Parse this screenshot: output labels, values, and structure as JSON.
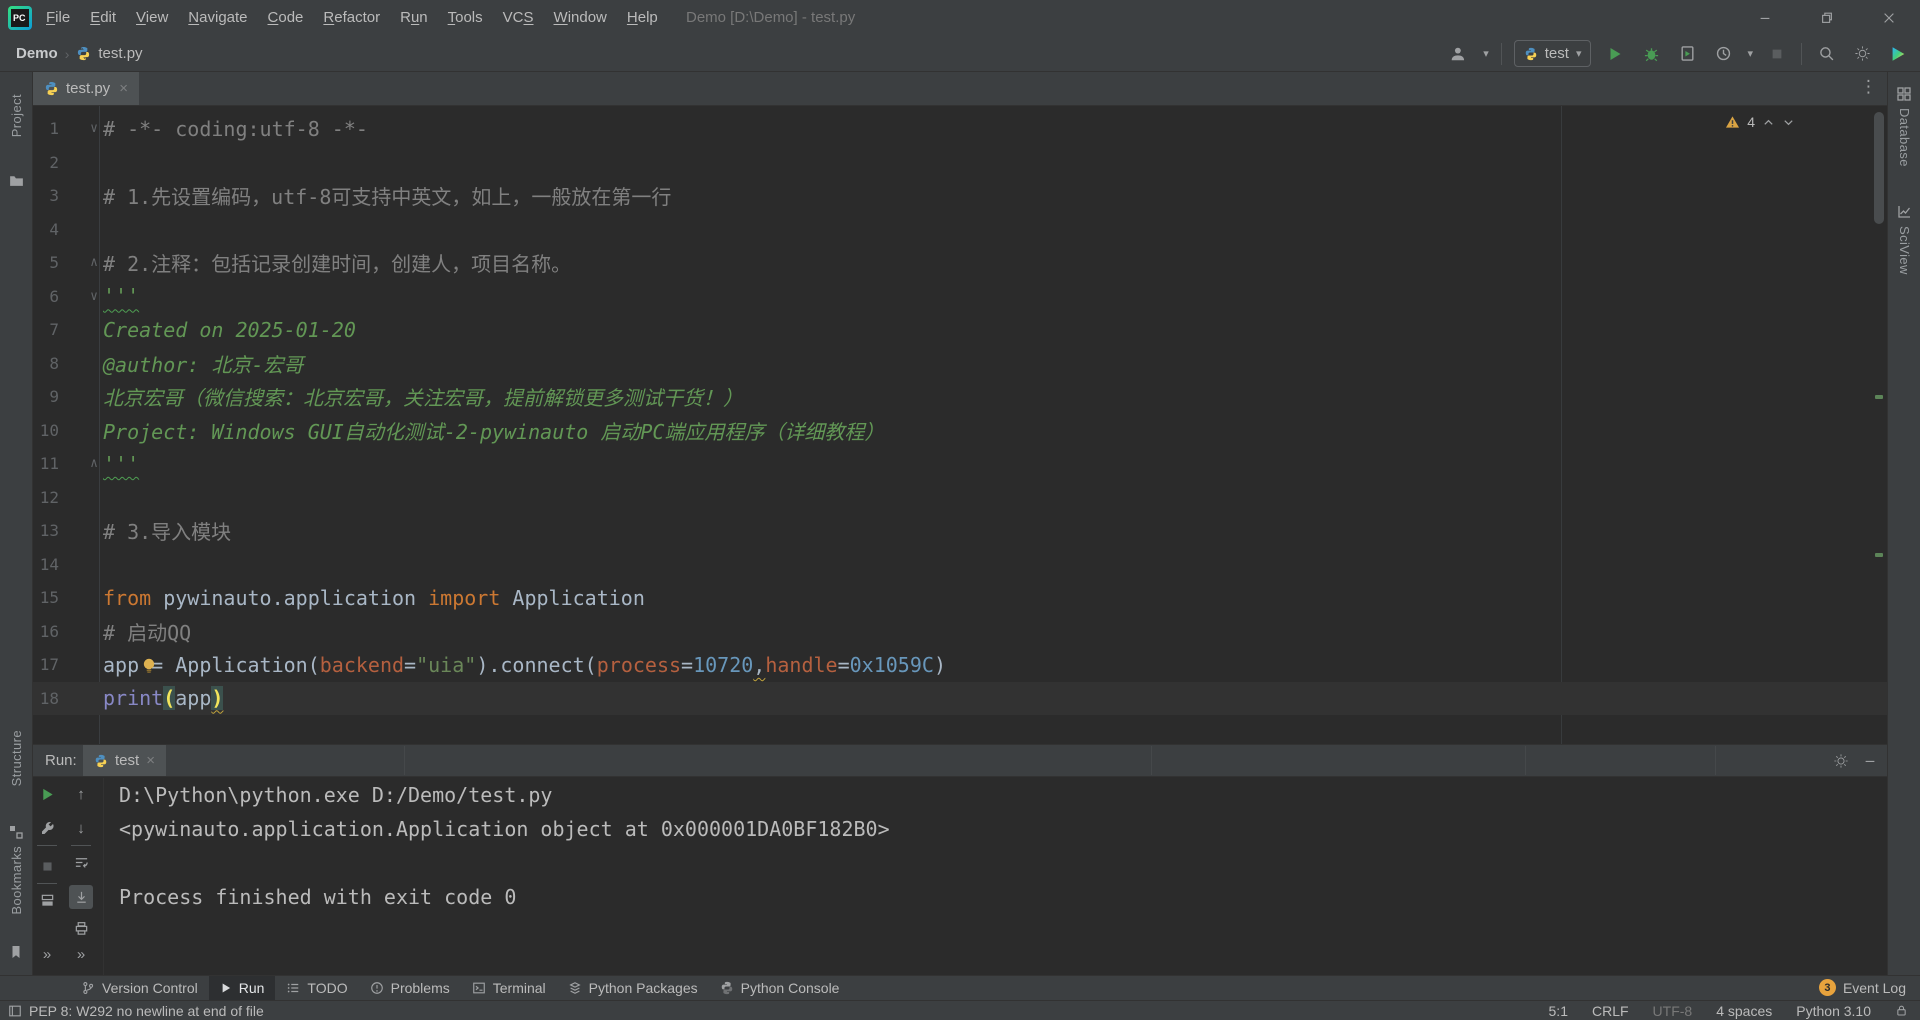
{
  "title_bar": {
    "menus": [
      {
        "label": "File",
        "u": 0
      },
      {
        "label": "Edit",
        "u": 0
      },
      {
        "label": "View",
        "u": 0
      },
      {
        "label": "Navigate",
        "u": 0
      },
      {
        "label": "Code",
        "u": 0
      },
      {
        "label": "Refactor",
        "u": 0
      },
      {
        "label": "Run",
        "u": 1
      },
      {
        "label": "Tools",
        "u": 0
      },
      {
        "label": "VCS",
        "u": 2
      },
      {
        "label": "Window",
        "u": 0
      },
      {
        "label": "Help",
        "u": 0
      }
    ],
    "title": "Demo [D:\\Demo] - test.py"
  },
  "navbar": {
    "project": "Demo",
    "file": "test.py",
    "run_config": "test"
  },
  "icons": {
    "breadcrumb_sep": "›",
    "caret": "▾",
    "more": "⋮",
    "close_x": "×",
    "chevrons": "»",
    "up": "↑",
    "down": "↓",
    "fold_down": "∨",
    "fold_up": "∧"
  },
  "editor": {
    "tab": "test.py",
    "warnings": "4",
    "lines": [
      {
        "n": 1,
        "fold": "down",
        "tokens": [
          [
            "c",
            "# -*- coding:utf-8 -*-"
          ]
        ]
      },
      {
        "n": 2,
        "tokens": []
      },
      {
        "n": 3,
        "tokens": [
          [
            "c",
            "# 1.先设置编码，utf-8可支持中英文，如上，一般放在第一行"
          ]
        ]
      },
      {
        "n": 4,
        "tokens": []
      },
      {
        "n": 5,
        "fold": "up",
        "tokens": [
          [
            "c",
            "# 2.注释：包括记录创建时间，创建人，项目名称。"
          ]
        ]
      },
      {
        "n": 6,
        "fold": "down",
        "tokens": [
          [
            "dw",
            "'''"
          ]
        ]
      },
      {
        "n": 7,
        "tokens": [
          [
            "d",
            "Created on 2025-01-20"
          ]
        ]
      },
      {
        "n": 8,
        "tokens": [
          [
            "d",
            "@author: 北京-宏哥"
          ]
        ]
      },
      {
        "n": 9,
        "tokens": [
          [
            "d",
            "北京宏哥（微信搜索：北京宏哥，关注宏哥，提前解锁更多测试干货！）"
          ]
        ]
      },
      {
        "n": 10,
        "tokens": [
          [
            "d",
            "Project: Windows GUI自动化测试-2-pywinauto 启动PC端应用程序（详细教程）"
          ]
        ]
      },
      {
        "n": 11,
        "fold": "up",
        "tokens": [
          [
            "dw",
            "'''"
          ]
        ]
      },
      {
        "n": 12,
        "tokens": []
      },
      {
        "n": 13,
        "tokens": [
          [
            "c",
            "# 3.导入模块"
          ]
        ]
      },
      {
        "n": 14,
        "tokens": []
      },
      {
        "n": 15,
        "tokens": [
          [
            "k",
            "from"
          ],
          [
            "t",
            " pywinauto.application "
          ],
          [
            "k",
            "import"
          ],
          [
            "t",
            " Application"
          ]
        ]
      },
      {
        "n": 16,
        "tokens": [
          [
            "c",
            "# 启动QQ"
          ]
        ]
      },
      {
        "n": 17,
        "tokens": [
          [
            "t",
            "app = Application("
          ],
          [
            "p",
            "backend"
          ],
          [
            "t",
            "="
          ],
          [
            "s",
            "\"uia\""
          ],
          [
            "t",
            ").connect("
          ],
          [
            "p",
            "process"
          ],
          [
            "t",
            "="
          ],
          [
            "n",
            "10720"
          ],
          [
            "tw",
            ","
          ],
          [
            "p",
            "handle"
          ],
          [
            "t",
            "="
          ],
          [
            "n",
            "0x1059C"
          ],
          [
            "t",
            ")"
          ]
        ]
      },
      {
        "n": 18,
        "current": true,
        "tokens": [
          [
            "b",
            "print"
          ],
          [
            "m",
            "("
          ],
          [
            "t",
            "app"
          ],
          [
            "mw",
            ")"
          ]
        ]
      }
    ]
  },
  "run_panel": {
    "label": "Run:",
    "tab": "test",
    "output_lines": [
      "D:\\Python\\python.exe D:/Demo/test.py",
      "<pywinauto.application.Application object at 0x000001DA0BF182B0>",
      "",
      "Process finished with exit code 0"
    ]
  },
  "tool_window_bar": {
    "items": [
      "Version Control",
      "Run",
      "TODO",
      "Problems",
      "Terminal",
      "Python Packages",
      "Python Console"
    ],
    "active": "Run",
    "event_log": {
      "label": "Event Log",
      "badge": "3"
    }
  },
  "status_bar": {
    "message": "PEP 8: W292 no newline at end of file",
    "position": "5:1",
    "line_sep": "CRLF",
    "encoding": "UTF-8",
    "indent": "4 spaces",
    "interpreter": "Python 3.10"
  },
  "stripes": {
    "left_top": [
      "Project"
    ],
    "left_bottom": [
      "Structure",
      "Bookmarks"
    ],
    "right": [
      "Database",
      "SciView"
    ]
  },
  "colors": {
    "accent_green": "#499c54",
    "warning_yellow": "#d9a343",
    "badge_orange": "#e8a33d",
    "editor_bg": "#2b2b2b",
    "panel_bg": "#3c3f41"
  }
}
